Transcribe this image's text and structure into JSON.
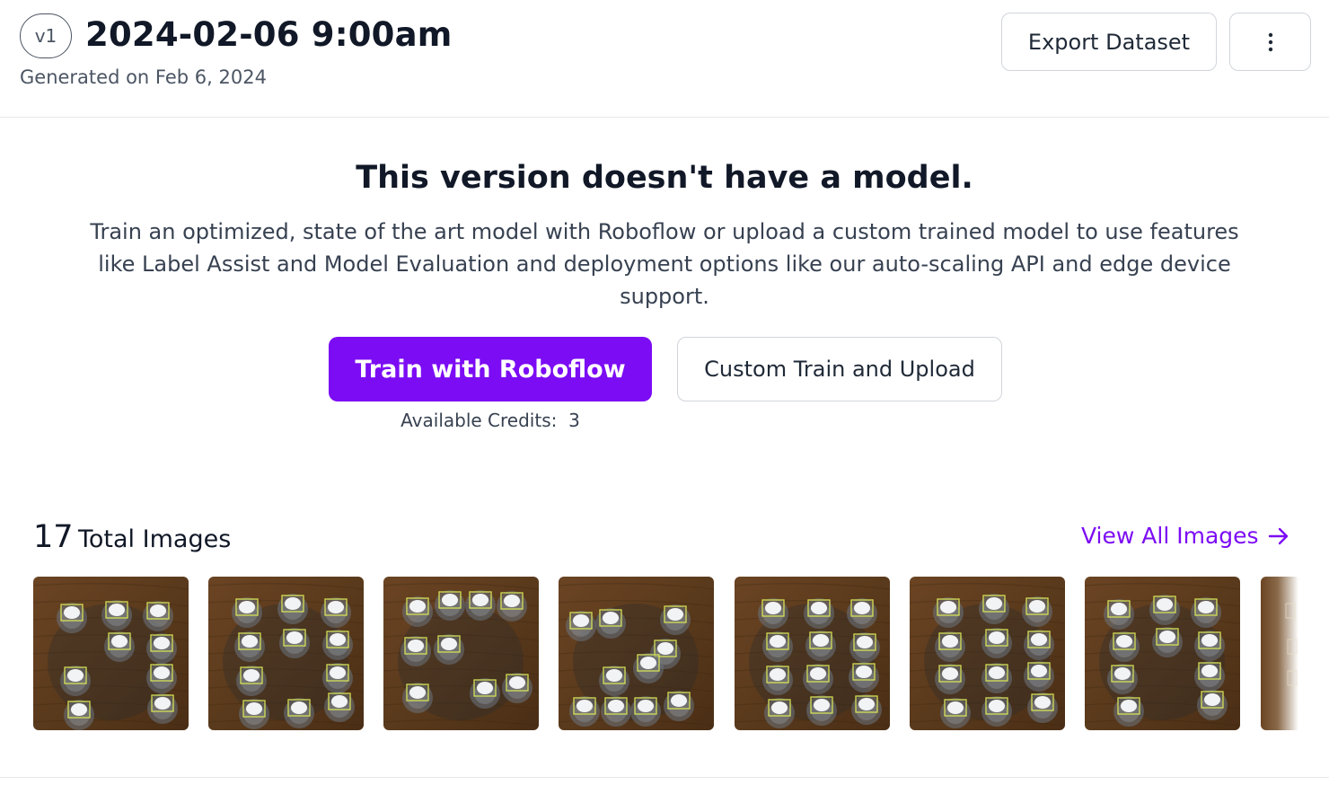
{
  "header": {
    "version_badge": "v1",
    "title": "2024-02-06 9:00am",
    "generated": "Generated on Feb 6, 2024",
    "export_label": "Export Dataset",
    "more_icon": "vertical-ellipsis-icon"
  },
  "model_empty": {
    "title": "This version doesn't have a model.",
    "description": "Train an optimized, state of the art model with Roboflow or upload a custom trained model to use features like Label Assist and Model Evaluation and deployment options like our auto-scaling API and edge device support.",
    "train_label": "Train with Roboflow",
    "custom_label": "Custom Train and Upload",
    "credits_label": "Available Credits:",
    "credits_value": "3"
  },
  "images": {
    "count": "17",
    "label": "Total Images",
    "view_all_label": "View All Images",
    "view_all_icon": "arrow-right-icon",
    "thumbnails_visible": 8
  },
  "colors": {
    "accent": "#7c0cf4",
    "wood": "#5a3a1c",
    "box": "#d4e157"
  }
}
